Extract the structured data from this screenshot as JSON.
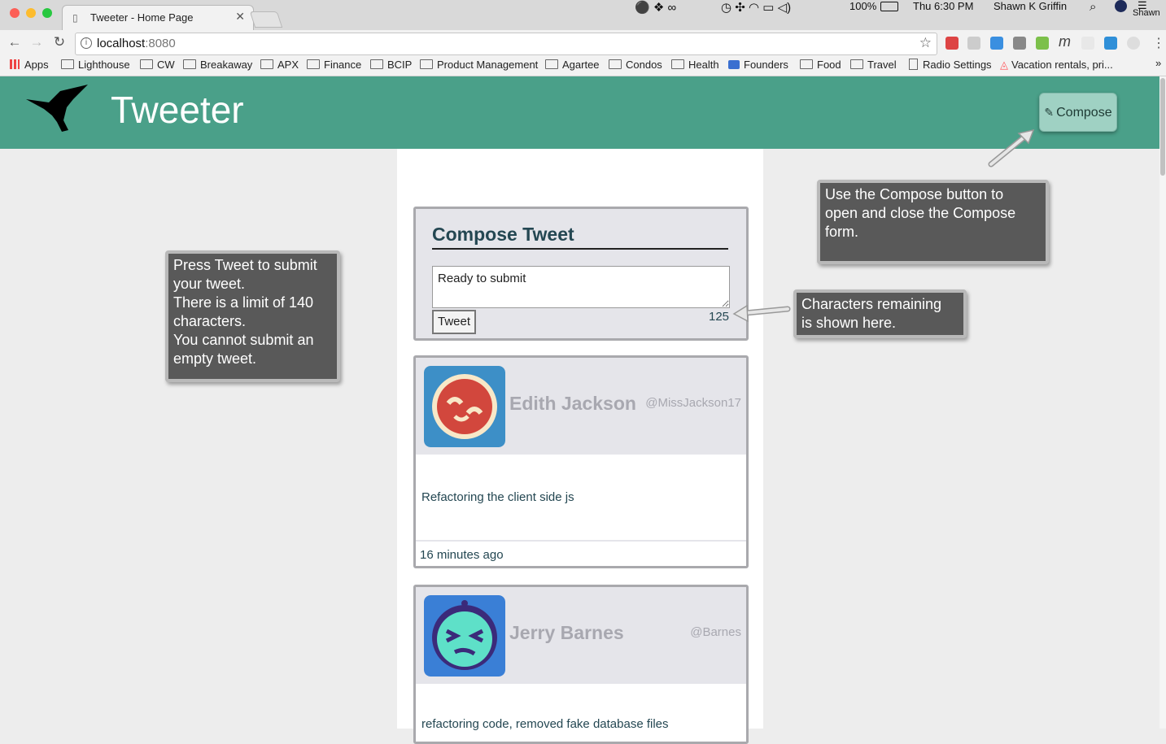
{
  "browser": {
    "tab_title": "Tweeter - Home Page",
    "url_host": "localhost",
    "url_port": ":8080",
    "status_battery": "100%",
    "status_time": "Thu 6:30 PM",
    "status_user": "Shawn K Griffin",
    "status_user_short": "Shawn",
    "bookmarks": [
      "Apps",
      "Lighthouse",
      "CW",
      "Breakaway",
      "APX",
      "Finance",
      "BCIP",
      "Product Management",
      "Agartee",
      "Condos",
      "Health",
      "Founders",
      "Food",
      "Travel",
      "Radio Settings",
      "Vacation rentals, pri..."
    ],
    "overflow": "»"
  },
  "header": {
    "title": "Tweeter",
    "compose_label": "Compose"
  },
  "compose": {
    "heading": "Compose Tweet",
    "text_value": "Ready to submit",
    "tweet_label": "Tweet",
    "counter": "125"
  },
  "tweets": [
    {
      "name": "Edith Jackson",
      "handle": "@MissJackson17",
      "text": "Refactoring the client side js",
      "time": "16 minutes ago"
    },
    {
      "name": "Jerry Barnes",
      "handle": "@Barnes",
      "text": "refactoring code, removed fake database files",
      "time": ""
    }
  ],
  "callouts": {
    "tweet_help": [
      "Press Tweet to submit",
      "your tweet.",
      "There is a limit of 140",
      "characters.",
      "You cannot submit an",
      "empty tweet."
    ],
    "compose_help": [
      "Use the Compose button to",
      "open and close the Compose",
      "form."
    ],
    "counter_help": [
      "Characters remaining",
      "is shown here."
    ]
  },
  "colors": {
    "header_bg": "#4aa089",
    "accent_text": "#244752",
    "compose_btn": "#9fd1c3"
  }
}
